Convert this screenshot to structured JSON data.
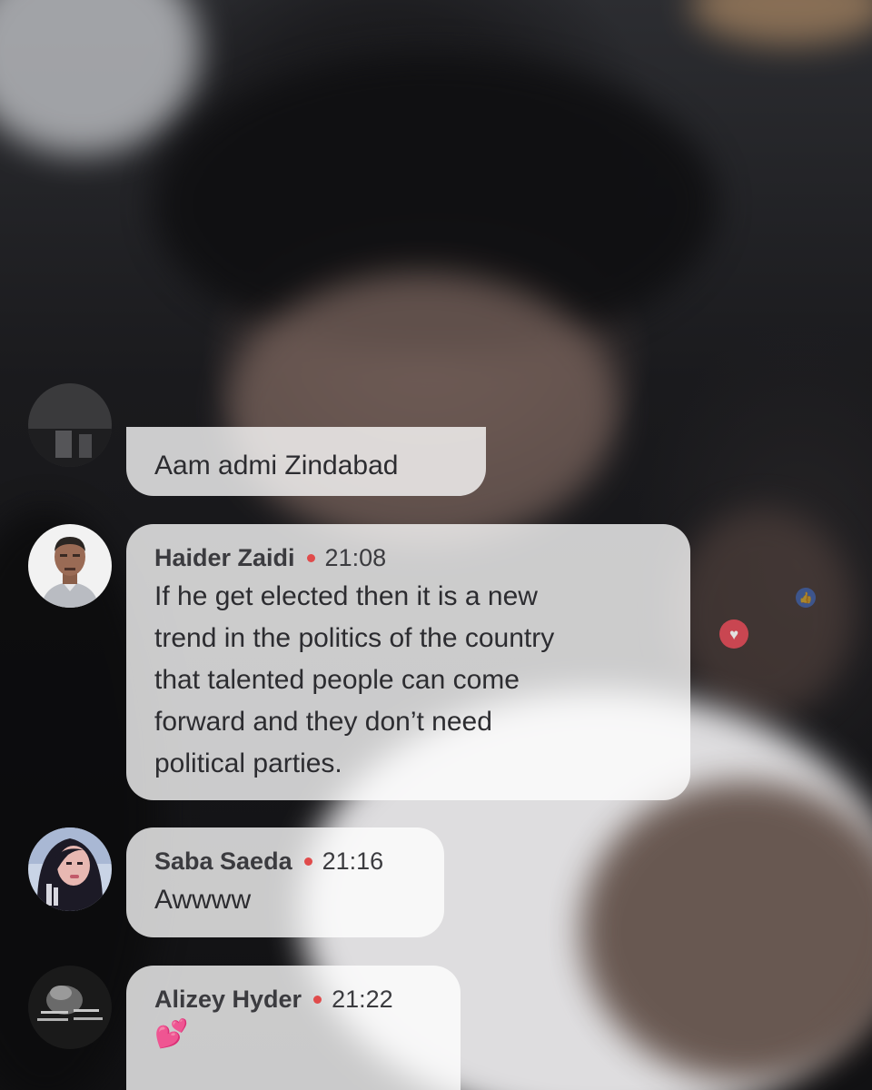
{
  "comments": [
    {
      "author": "",
      "time": "",
      "message": "Aam admi Zindabad",
      "avatar_icon": "user-avatar-dark-icon"
    },
    {
      "author": "Haider Zaidi",
      "time": "21:08",
      "message": "If he get elected then it is a new\ntrend in the politics of the country\nthat talented people can come\nforward and they don’t need\npolitical parties.",
      "avatar_icon": "user-avatar-man-icon"
    },
    {
      "author": "Saba Saeda",
      "time": "21:16",
      "message": "Awwww",
      "avatar_icon": "user-avatar-woman-icon"
    },
    {
      "author": "Alizey Hyder",
      "time": "21:22",
      "message": "💕",
      "avatar_icon": "user-avatar-bw-icon"
    }
  ],
  "reactions": {
    "like_icon": "thumbs-up-icon",
    "like_glyph": "👍",
    "love_icon": "heart-icon",
    "love_glyph": "♥"
  },
  "colors": {
    "separator_dot": "#e04b4b",
    "bubble": "#ffffffc7",
    "like": "#3b6fd4",
    "love": "#e24a57"
  }
}
